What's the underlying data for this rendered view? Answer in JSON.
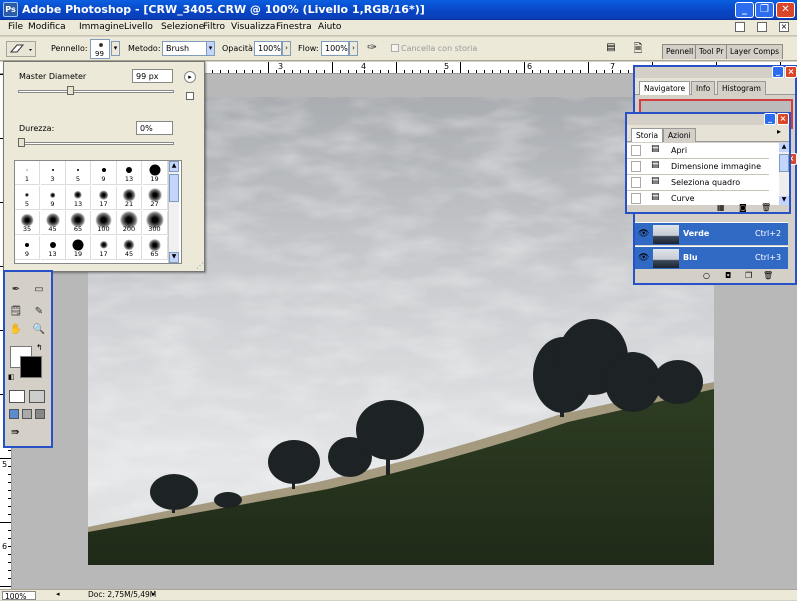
{
  "window": {
    "title": "Adobe Photoshop - [CRW_3405.CRW @ 100% (Livello 1,RGB/16*)]",
    "logo": "Ps"
  },
  "window_controls": [
    "_",
    "❐",
    "✕"
  ],
  "menu": [
    "File",
    "Modifica",
    "Immagine",
    "Livello",
    "Selezione",
    "Filtro",
    "Visualizza",
    "Finestra",
    "Aiuto"
  ],
  "options": {
    "brush_label": "Pennello:",
    "brush_size": "99",
    "mode_label": "Metodo:",
    "mode_value": "Brush",
    "opacity_label": "Opacità:",
    "opacity_value": "100%",
    "flow_label": "Flow:",
    "flow_value": "100%",
    "erase_to_history_label": "Cancella con storia"
  },
  "dock_tabs": [
    "Pennell",
    "Tool Pr",
    "Layer Comps"
  ],
  "brush_popup": {
    "master_diameter_label": "Master Diameter",
    "master_diameter_value": "99 px",
    "master_diameter_level": 0.33,
    "hardness_label": "Durezza:",
    "hardness_value": "0%",
    "hardness_level": 0.0,
    "brushes": [
      {
        "size": "1",
        "d": 1,
        "soft": false
      },
      {
        "size": "3",
        "d": 2,
        "soft": false
      },
      {
        "size": "5",
        "d": 2,
        "soft": false
      },
      {
        "size": "9",
        "d": 4,
        "soft": false
      },
      {
        "size": "13",
        "d": 6,
        "soft": false
      },
      {
        "size": "19",
        "d": 11,
        "soft": false
      },
      {
        "size": "5",
        "d": 3,
        "soft": true
      },
      {
        "size": "9",
        "d": 4,
        "soft": true
      },
      {
        "size": "13",
        "d": 6,
        "soft": true
      },
      {
        "size": "17",
        "d": 7,
        "soft": true
      },
      {
        "size": "21",
        "d": 9,
        "soft": true
      },
      {
        "size": "27",
        "d": 10,
        "soft": true
      },
      {
        "size": "35",
        "d": 9,
        "soft": true
      },
      {
        "size": "45",
        "d": 10,
        "soft": true
      },
      {
        "size": "65",
        "d": 11,
        "soft": true
      },
      {
        "size": "100",
        "d": 12,
        "soft": true
      },
      {
        "size": "200",
        "d": 13,
        "soft": true
      },
      {
        "size": "300",
        "d": 13,
        "soft": true
      },
      {
        "size": "9",
        "d": 4,
        "soft": false
      },
      {
        "size": "13",
        "d": 6,
        "soft": false
      },
      {
        "size": "19",
        "d": 11,
        "soft": false
      },
      {
        "size": "17",
        "d": 6,
        "soft": true
      },
      {
        "size": "45",
        "d": 8,
        "soft": true
      },
      {
        "size": "65",
        "d": 9,
        "soft": true
      }
    ]
  },
  "rulers": {
    "top": [
      "1",
      "2",
      "3",
      "4",
      "5",
      "6",
      "7"
    ],
    "left": [
      "5",
      "6"
    ]
  },
  "navigator_panel": {
    "tabs": [
      "Navigatore",
      "Info",
      "Histogram"
    ]
  },
  "history_panel": {
    "tabs": [
      "Storia",
      "Azioni"
    ],
    "items": [
      "Apri",
      "Dimensione immagine",
      "Seleziona quadro",
      "Curve"
    ]
  },
  "channels": [
    {
      "name": "Verde",
      "shortcut": "Ctrl+2"
    },
    {
      "name": "Blu",
      "shortcut": "Ctrl+3"
    }
  ],
  "status": {
    "zoom": "100%",
    "doc": "Doc: 2,75M/5,49M"
  },
  "colors": {
    "title_blue": "#0a5fe0",
    "selection_blue": "#316ac5",
    "panel_border": "#2851c8",
    "chrome": "#ece9d8"
  }
}
